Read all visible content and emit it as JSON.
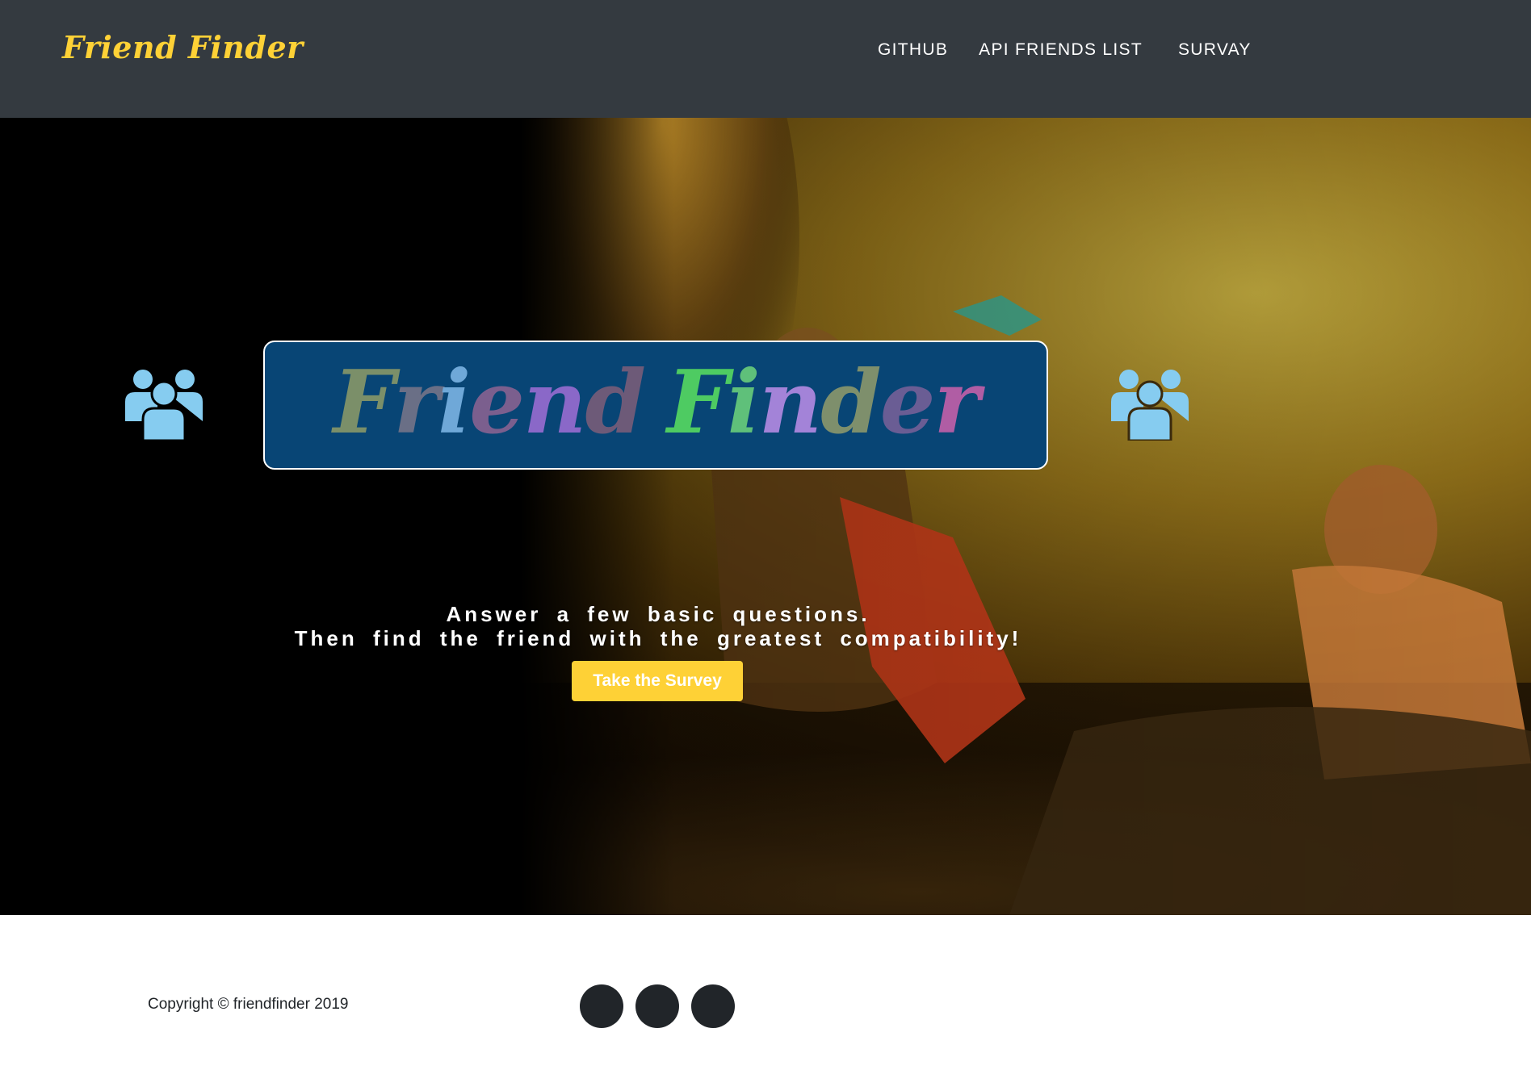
{
  "navbar": {
    "brand": "Friend Finder",
    "links": [
      {
        "label": "GITHUB"
      },
      {
        "label": "API FRIENDS LIST"
      },
      {
        "label": "SURVAY"
      }
    ]
  },
  "hero": {
    "title_letters": [
      {
        "char": "F",
        "color": "#7b8f69"
      },
      {
        "char": "r",
        "color": "#6a6f86"
      },
      {
        "char": "i",
        "color": "#6fa8d8"
      },
      {
        "char": "e",
        "color": "#7b5f8e"
      },
      {
        "char": "n",
        "color": "#8a68c8"
      },
      {
        "char": "d",
        "color": "#6d5a78"
      },
      {
        "char": " ",
        "color": "#ffffff"
      },
      {
        "char": "F",
        "color": "#4ecb62"
      },
      {
        "char": "i",
        "color": "#5fc07a"
      },
      {
        "char": "n",
        "color": "#a383d8"
      },
      {
        "char": "d",
        "color": "#7e8f6c"
      },
      {
        "char": "e",
        "color": "#6a5d94"
      },
      {
        "char": "r",
        "color": "#b05da4"
      }
    ],
    "tagline_line1": "Answer a few basic questions.",
    "tagline_line2": "Then find the friend with the greatest compatibility!",
    "cta_label": "Take the Survey",
    "icon": "users-icon"
  },
  "footer": {
    "copyright": "Copyright © friendfinder 2019",
    "social_icons": [
      "social-icon-1",
      "social-icon-2",
      "social-icon-3"
    ]
  },
  "colors": {
    "navbar_bg": "#343a40",
    "accent": "#fed136",
    "title_box_bg": "#084575",
    "icon_color": "#86ccf0",
    "footer_circle": "#212529"
  }
}
